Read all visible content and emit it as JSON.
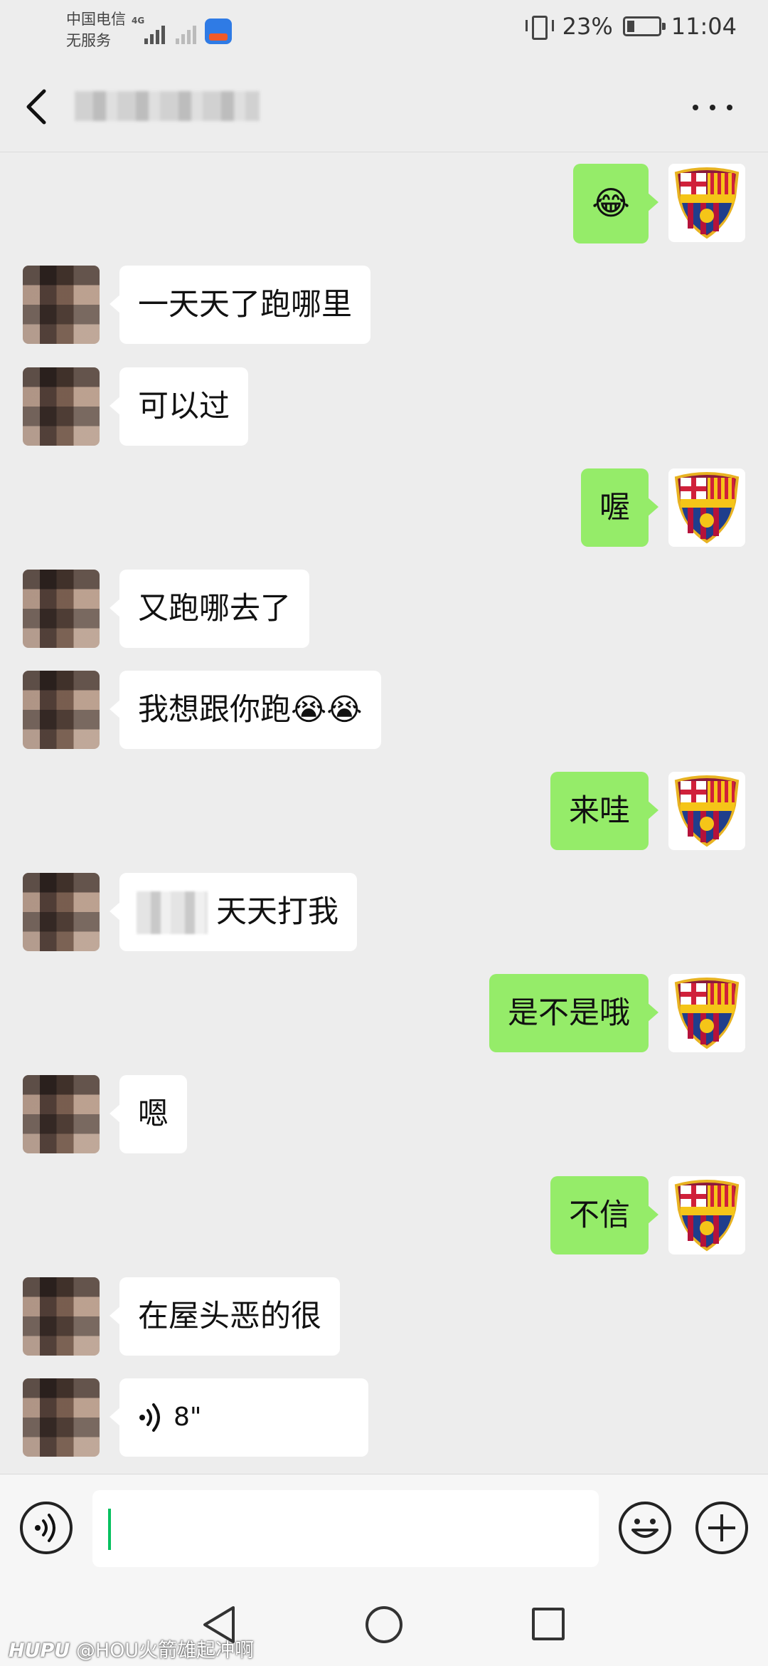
{
  "status_bar": {
    "carrier_line1": "中国电信",
    "carrier_line2": "无服务",
    "network_type": "4G",
    "battery_percent": "23%",
    "time": "11:04"
  },
  "title_bar": {
    "icons": {
      "back": "back-arrow-icon",
      "more": "more-dots-icon"
    }
  },
  "messages": [
    {
      "side": "right",
      "text": "😂"
    },
    {
      "side": "left",
      "text": "一天天了跑哪里"
    },
    {
      "side": "left",
      "text": "可以过"
    },
    {
      "side": "right",
      "text": "喔"
    },
    {
      "side": "left",
      "text": "又跑哪去了"
    },
    {
      "side": "left",
      "text": "我想跟你跑😭😭"
    },
    {
      "side": "right",
      "text": "来哇"
    },
    {
      "side": "left",
      "text": "天天打我",
      "partially_obscured": true
    },
    {
      "side": "right",
      "text": "是不是哦"
    },
    {
      "side": "left",
      "text": "嗯"
    },
    {
      "side": "right",
      "text": "不信"
    },
    {
      "side": "left",
      "text": "在屋头恶的很"
    },
    {
      "side": "left",
      "type": "voice",
      "duration": "8\""
    }
  ],
  "input_bar": {
    "input_value": "",
    "icons": {
      "voice_toggle": "voice-toggle-icon",
      "emoji": "smiley-icon",
      "plus": "plus-circle-icon"
    }
  },
  "nav_bar": {
    "icons": {
      "back": "nav-back-triangle-icon",
      "home": "nav-home-circle-icon",
      "recent": "nav-recent-square-icon"
    }
  },
  "watermark": {
    "brand": "HUPU",
    "text": "@HOU火箭雄起冲啊"
  },
  "colors": {
    "background": "#ededed",
    "sent_bubble": "#95ec69",
    "received_bubble": "#ffffff",
    "cursor": "#07c160"
  }
}
